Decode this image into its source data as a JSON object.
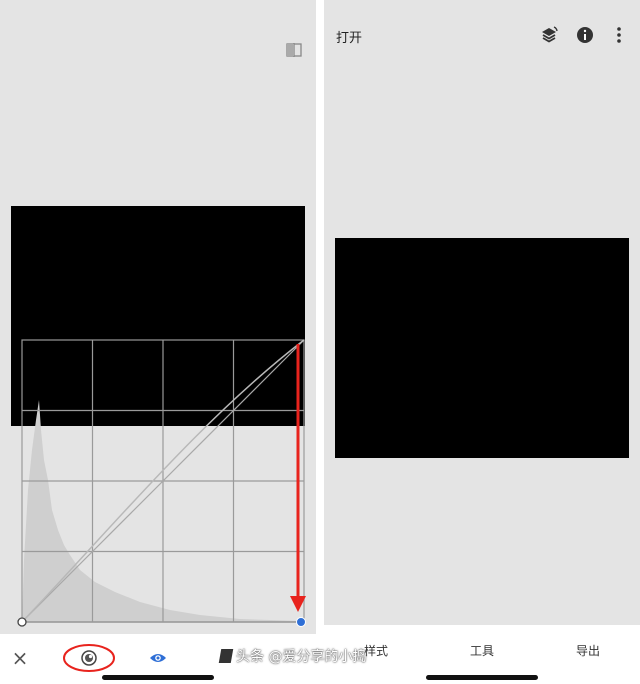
{
  "left_panel": {
    "compare_icon": "compare-icon",
    "bottom_bar": {
      "close_label": "×",
      "curve_icon": "curves-icon",
      "eye_icon": "eye-icon"
    },
    "annotation_color": "#e8231d",
    "accent_color": "#2f6fd6"
  },
  "right_panel": {
    "open_label": "打开",
    "icons": [
      "layers-icon",
      "info-icon",
      "more-vert-icon"
    ],
    "tabs": [
      "样式",
      "工具",
      "导出"
    ]
  },
  "watermark": {
    "text": "头条 @爱分享的小捣"
  }
}
